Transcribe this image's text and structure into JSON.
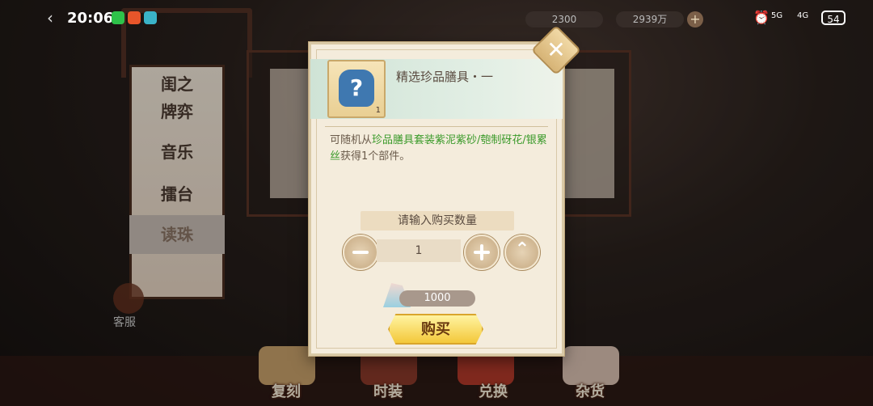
{
  "status_bar": {
    "time": "20:06",
    "battery": "54",
    "network": [
      "5G",
      "4G"
    ]
  },
  "currencies": [
    {
      "value": "2300"
    },
    {
      "value": "2939万"
    }
  ],
  "menu": {
    "items": [
      "闺之",
      "牌弈",
      "音乐",
      "擂台",
      "读珠"
    ],
    "active_index": 4
  },
  "customer_service": {
    "label": "客服"
  },
  "bottom_nav": [
    "复刻",
    "时装",
    "兑换",
    "杂货"
  ],
  "dialog": {
    "item_name": "精选珍品膳具・一",
    "item_count": "1",
    "description": [
      {
        "text": "可随机从",
        "highlight": false
      },
      {
        "text": "珍品膳具套装紫泥紫砂/匏制砑花/银累丝",
        "highlight": true
      },
      {
        "text": "获得1个部件。",
        "highlight": false
      }
    ],
    "quantity_prompt": "请输入购买数量",
    "quantity": "1",
    "price": "1000",
    "buy_label": "购买"
  },
  "colors": {
    "highlight_green": "#3a9a2a",
    "buy_gold": "#f3c83a"
  }
}
